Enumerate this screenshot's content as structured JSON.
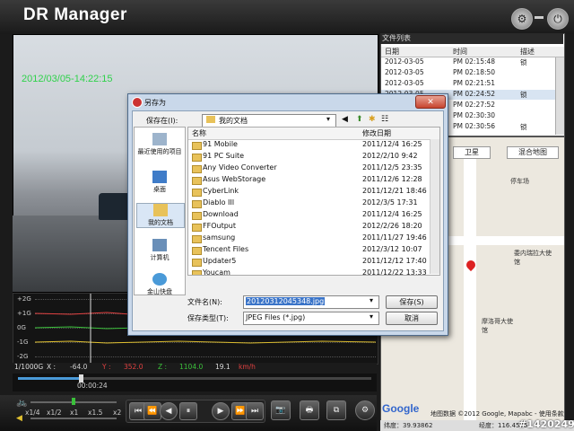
{
  "app": {
    "title": "DR Manager"
  },
  "window_controls": {
    "settings_icon": "gear-icon",
    "power_icon": "power-icon"
  },
  "video": {
    "timestamp": "2012/03/05-14:22:15"
  },
  "filelist": {
    "title": "文件列表",
    "headers": [
      "日期",
      "时间",
      "描述"
    ],
    "rows": [
      {
        "date": "2012-03-05",
        "time": "PM 02:15:48",
        "desc": "锁"
      },
      {
        "date": "2012-03-05",
        "time": "PM 02:18:50",
        "desc": ""
      },
      {
        "date": "2012-03-05",
        "time": "PM 02:21:51",
        "desc": ""
      },
      {
        "date": "2012-03-05",
        "time": "PM 02:24:52",
        "desc": "锁"
      },
      {
        "date": "2012-03-05",
        "time": "PM 02:27:52",
        "desc": ""
      },
      {
        "date": "2012-03-05",
        "time": "PM 02:30:30",
        "desc": ""
      },
      {
        "date": "2012-03-05",
        "time": "PM 02:30:56",
        "desc": "锁"
      }
    ]
  },
  "map": {
    "tabs": [
      "卫星",
      "混合地图"
    ],
    "labels": [
      "停车场",
      "委内瑞拉大使馆",
      "摩洛哥大使馆"
    ],
    "google": "Google",
    "footer": "地图数据 ©2012 Google, Mapabc - 使用条款",
    "latitude": "纬度：39.93862",
    "longitude": "经度：116.4555"
  },
  "graph": {
    "labels": [
      "+2G",
      "+1G",
      "0G",
      "-1G",
      "-2G"
    ],
    "scale": "1/1000G",
    "x_label": "X :",
    "x_value": "-64.0",
    "y_label": "Y :",
    "y_value": "352.0",
    "z_label": "Z :",
    "z_value": "1104.0",
    "speed_value": "19.1",
    "speed_unit": "km/h"
  },
  "timeline": {
    "time": "00:00:24"
  },
  "playback": {
    "speeds": [
      "x1/4",
      "x1/2",
      "x1",
      "x1.5",
      "x2"
    ]
  },
  "dialog": {
    "title": "另存为",
    "save_in_label": "保存在(I):",
    "save_in_value": "我的文档",
    "places": [
      "最近使用的项目",
      "桌面",
      "我的文档",
      "计算机",
      "金山快盘"
    ],
    "col_name": "名称",
    "col_date": "修改日期",
    "files": [
      {
        "name": "91 Mobile",
        "date": "2011/12/4 16:25"
      },
      {
        "name": "91 PC Suite",
        "date": "2012/2/10 9:42"
      },
      {
        "name": "Any Video Converter",
        "date": "2011/12/5 23:35"
      },
      {
        "name": "Asus WebStorage",
        "date": "2011/12/6 12:28"
      },
      {
        "name": "CyberLink",
        "date": "2011/12/21 18:46"
      },
      {
        "name": "Diablo III",
        "date": "2012/3/5 17:31"
      },
      {
        "name": "Download",
        "date": "2011/12/4 16:25"
      },
      {
        "name": "FFOutput",
        "date": "2012/2/26 18:20"
      },
      {
        "name": "samsung",
        "date": "2011/11/27 19:46"
      },
      {
        "name": "Tencent Files",
        "date": "2012/3/12 10:07"
      },
      {
        "name": "Updater5",
        "date": "2011/12/12 17:40"
      },
      {
        "name": "Youcam",
        "date": "2011/12/22 13:33"
      }
    ],
    "filename_label": "文件名(N):",
    "filename_value": "20120312045348.jpg",
    "filetype_label": "保存类型(T):",
    "filetype_value": "JPEG Files (*.jpg)",
    "save_button": "保存(S)",
    "cancel_button": "取消"
  },
  "watermark": "#1420249"
}
